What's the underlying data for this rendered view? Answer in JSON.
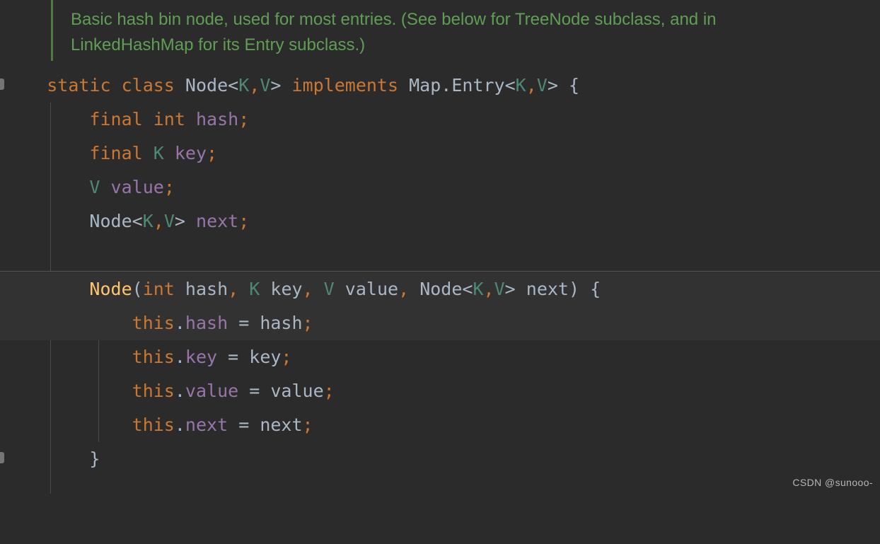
{
  "editor": {
    "background": "#2b2b2b",
    "highlight_background": "#323232",
    "watermark": "CSDN @sunooo-"
  },
  "colors": {
    "keyword": "#cc7832",
    "comment": "#5f9e54",
    "comment_bar": "#4e7a44",
    "class_name": "#a9b7c6",
    "generic_param": "#4e8975",
    "instance_field": "#9876aa",
    "constructor_name": "#ffc66d",
    "indent_guide": "#4b4b4b",
    "separator": "#555555",
    "watermark_text": "#b6b6b6"
  },
  "comment": {
    "line1": "Basic hash bin node, used for most entries. (See below for TreeNode subclass, and in",
    "line2": "LinkedHashMap for its Entry subclass.)"
  },
  "code": {
    "class_decl": {
      "kw_static": "static",
      "kw_class": "class",
      "name": "Node",
      "lt": "<",
      "k": "K",
      "comma": ",",
      "v": "V",
      "gt": ">",
      "kw_implements": "implements",
      "iface_map": "Map",
      "dot": ".",
      "iface_entry": "Entry",
      "open_brace": "{"
    },
    "field_hash": {
      "kw_final": "final",
      "kw_int": "int",
      "name": "hash",
      "semi": ";"
    },
    "field_key": {
      "kw_final": "final",
      "type_k": "K",
      "name": "key",
      "semi": ";"
    },
    "field_value": {
      "type_v": "V",
      "name": "value",
      "semi": ";"
    },
    "field_next": {
      "type_node": "Node",
      "lt": "<",
      "k": "K",
      "comma": ",",
      "v": "V",
      "gt": ">",
      "name": "next",
      "semi": ";"
    },
    "ctor_sig": {
      "name": "Node",
      "lparen": "(",
      "kw_int": "int",
      "p_hash": "hash",
      "comma1": ",",
      "type_k": "K",
      "p_key": "key",
      "comma2": ",",
      "type_v": "V",
      "p_value": "value",
      "comma3": ",",
      "type_node": "Node",
      "lt": "<",
      "k": "K",
      "gcomma": ",",
      "v": "V",
      "gt": ">",
      "p_next": "next",
      "rparen": ")",
      "open_brace": "{"
    },
    "assign_hash": {
      "kw_this": "this",
      "dot": ".",
      "field": "hash",
      "eq": "=",
      "value": "hash",
      "semi": ";"
    },
    "assign_key": {
      "kw_this": "this",
      "dot": ".",
      "field": "key",
      "eq": "=",
      "value": "key",
      "semi": ";"
    },
    "assign_value": {
      "kw_this": "this",
      "dot": ".",
      "field": "value",
      "eq": "=",
      "value": "value",
      "semi": ";"
    },
    "assign_next": {
      "kw_this": "this",
      "dot": ".",
      "field": "next",
      "eq": "=",
      "value": "next",
      "semi": ";"
    },
    "ctor_close": {
      "brace": "}"
    },
    "indent": {
      "l0": "",
      "l1": "    ",
      "l2": "        ",
      "space": " "
    }
  }
}
